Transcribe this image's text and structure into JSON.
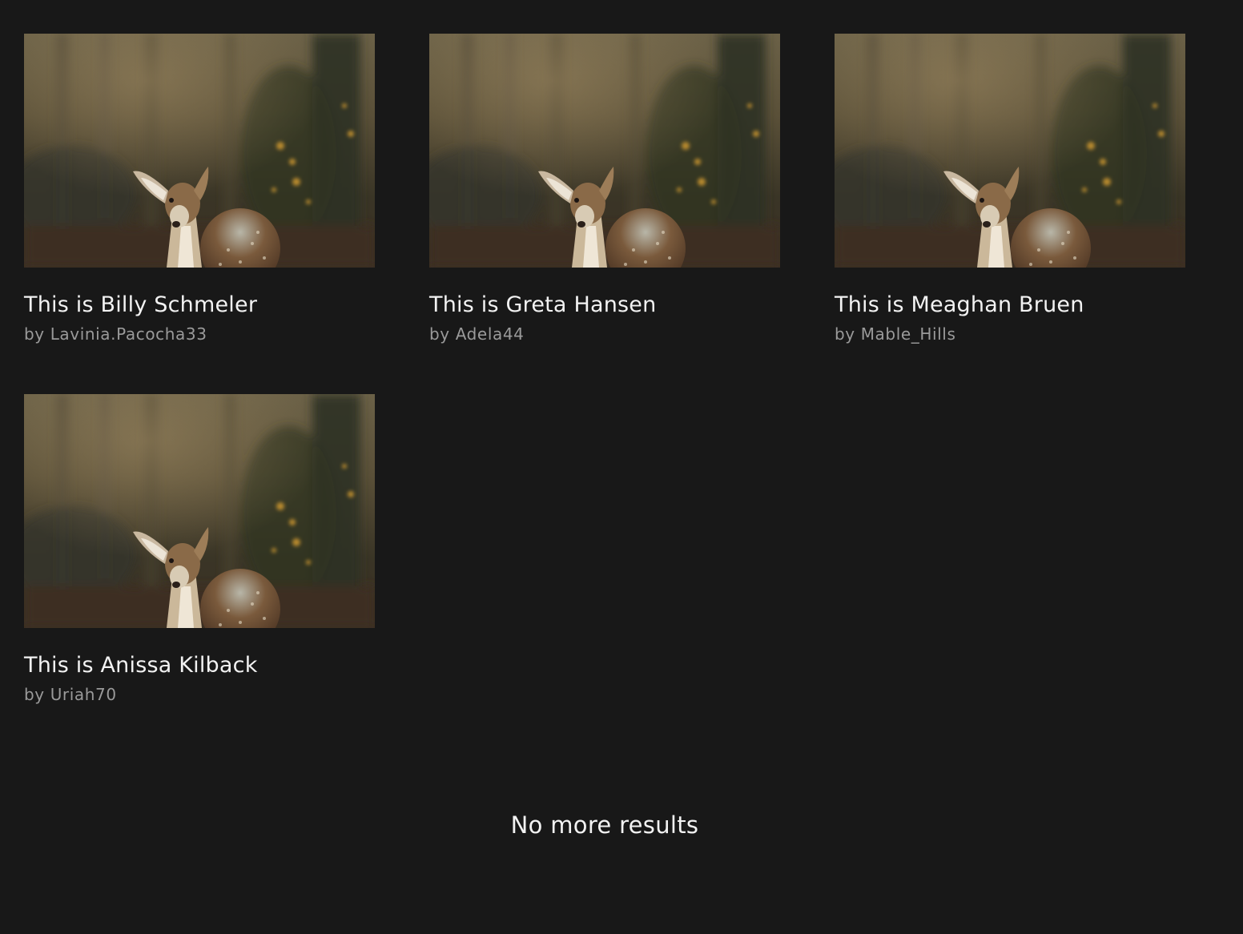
{
  "results": [
    {
      "title": "This is Billy Schmeler",
      "author": "by Lavinia.Pacocha33",
      "image": "fawn-in-forest-photo"
    },
    {
      "title": "This is Greta Hansen",
      "author": "by Adela44",
      "image": "fawn-in-forest-photo"
    },
    {
      "title": "This is Meaghan Bruen",
      "author": "by Mable_Hills",
      "image": "fawn-in-forest-photo"
    },
    {
      "title": "This is Anissa Kilback",
      "author": "by Uriah70",
      "image": "fawn-in-forest-photo"
    }
  ],
  "end_message": "No more results",
  "colors": {
    "background": "#181818",
    "title": "#f2f2f2",
    "author": "#9a9a9a"
  }
}
